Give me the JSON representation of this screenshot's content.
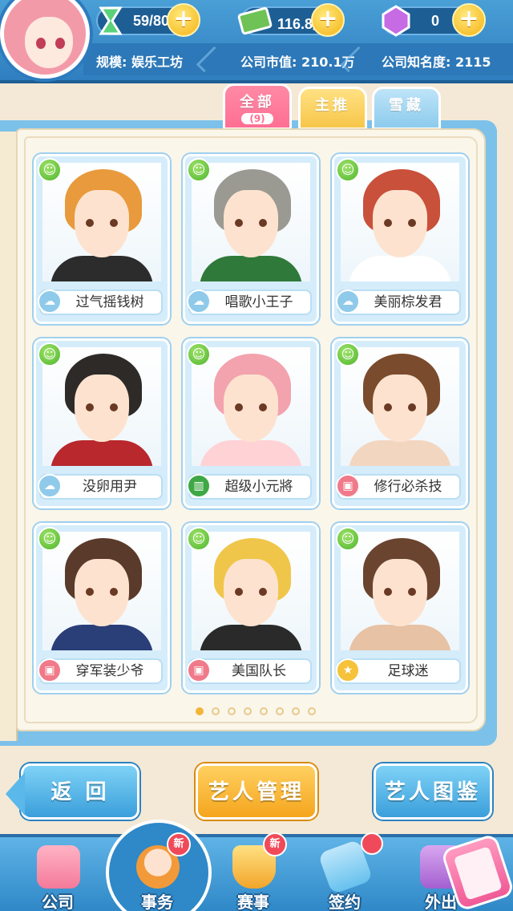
{
  "hud": {
    "energy": "59/80",
    "money": "116.8万",
    "gems": "0",
    "scale_label": "规模: 娱乐工坊",
    "market_value_label": "公司市值: 210.1万",
    "fame_label": "公司知名度: 2115",
    "plus": "+"
  },
  "tabs": [
    {
      "label": "全部",
      "count": "(9)"
    },
    {
      "label": "主推"
    },
    {
      "label": "雪藏"
    }
  ],
  "artists": [
    {
      "name": "过气摇钱树",
      "tag_icon": "cloud-icon",
      "hair": "#e89a3c",
      "outfit": "#2c2c2c"
    },
    {
      "name": "唱歌小王子",
      "tag_icon": "cloud-icon",
      "hair": "#9a9a92",
      "outfit": "#2f7a3a"
    },
    {
      "name": "美丽棕发君",
      "tag_icon": "cloud-icon",
      "hair": "#c9503a",
      "outfit": "#ffffff"
    },
    {
      "name": "没卵用尹",
      "tag_icon": "cloud-icon",
      "hair": "#2e2a28",
      "outfit": "#b8282d"
    },
    {
      "name": "超级小元將",
      "tag_icon": "book-icon",
      "hair": "#f3a3ad",
      "outfit": "#ffd2d6"
    },
    {
      "name": "修行必杀技",
      "tag_icon": "clapper-icon",
      "hair": "#7a4b2c",
      "outfit": "#f3d6c0"
    },
    {
      "name": "穿军装少爷",
      "tag_icon": "clapper-icon",
      "hair": "#5a3a2a",
      "outfit": "#2a3e78"
    },
    {
      "name": "美国队长",
      "tag_icon": "clapper-icon",
      "hair": "#f0c64a",
      "outfit": "#2a2a2a"
    },
    {
      "name": "足球迷",
      "tag_icon": "star-icon",
      "hair": "#6b4430",
      "outfit": "#e7c2a5"
    }
  ],
  "pagination": {
    "total": 8,
    "current": 1
  },
  "buttons": {
    "back": "返 回",
    "manage": "艺人管理",
    "guide": "艺人图鉴"
  },
  "nav": [
    {
      "label": "公司",
      "icon": "building-icon"
    },
    {
      "label": "事务",
      "icon": "manager-icon",
      "badge": "新",
      "active": true
    },
    {
      "label": "赛事",
      "icon": "trophy-icon",
      "badge": "新"
    },
    {
      "label": "签约",
      "icon": "contract-icon"
    },
    {
      "label": "外出",
      "icon": "go-out-icon"
    }
  ],
  "colors": {
    "accent_blue": "#3a9fdb",
    "accent_orange": "#f5a51d",
    "smiley_green": "#4eb52c",
    "tab_pink": "#ff6f93"
  }
}
